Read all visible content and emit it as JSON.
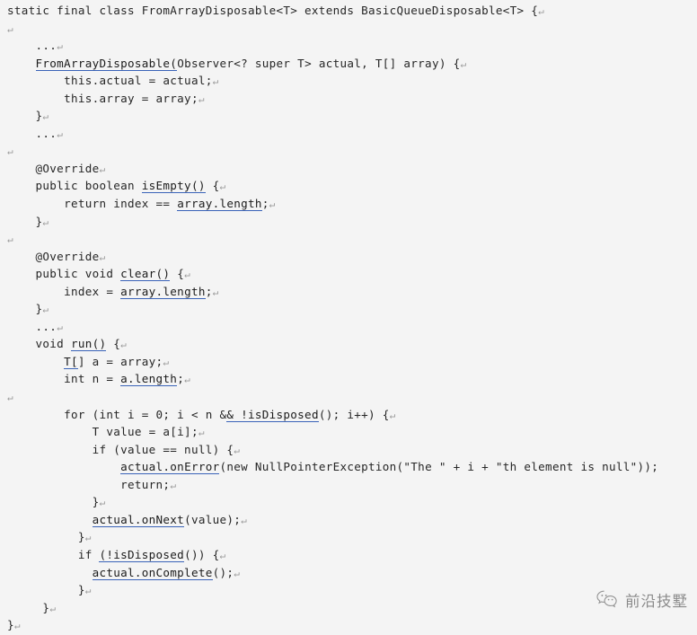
{
  "document": {
    "type": "source-code-screenshot",
    "language": "Java",
    "background_color": "#f4f4f4",
    "text_color": "#262626",
    "link_underline_color": "#3a63b8",
    "cr_glyph": "↵",
    "cr_color": "#9a9a9a"
  },
  "code": {
    "lines": [
      {
        "indent": 0,
        "tokens": [
          {
            "t": "static final class FromArrayDisposable<T> extends BasicQueueDisposable<T> {",
            "k": "plain"
          }
        ],
        "cr": true
      },
      {
        "indent": 0,
        "tokens": [],
        "cr": true
      },
      {
        "indent": 4,
        "tokens": [
          {
            "t": "...",
            "k": "plain"
          }
        ],
        "cr": true
      },
      {
        "indent": 4,
        "tokens": [
          {
            "t": "FromArrayDisposable(",
            "k": "link"
          },
          {
            "t": "Observer<? super T> actual, T[] array) {",
            "k": "plain"
          }
        ],
        "cr": true
      },
      {
        "indent": 8,
        "tokens": [
          {
            "t": "this.actual = actual;",
            "k": "plain"
          }
        ],
        "cr": true
      },
      {
        "indent": 8,
        "tokens": [
          {
            "t": "this.array = array;",
            "k": "plain"
          }
        ],
        "cr": true
      },
      {
        "indent": 4,
        "tokens": [
          {
            "t": "}",
            "k": "plain"
          }
        ],
        "cr": true
      },
      {
        "indent": 4,
        "tokens": [
          {
            "t": "...",
            "k": "plain"
          }
        ],
        "cr": true
      },
      {
        "indent": 0,
        "tokens": [],
        "cr": true
      },
      {
        "indent": 4,
        "tokens": [
          {
            "t": "@Override",
            "k": "plain"
          }
        ],
        "cr": true
      },
      {
        "indent": 4,
        "tokens": [
          {
            "t": "public boolean ",
            "k": "plain"
          },
          {
            "t": "isEmpty()",
            "k": "link"
          },
          {
            "t": " {",
            "k": "plain"
          }
        ],
        "cr": true
      },
      {
        "indent": 8,
        "tokens": [
          {
            "t": "return index == ",
            "k": "plain"
          },
          {
            "t": "array.length",
            "k": "link"
          },
          {
            "t": ";",
            "k": "plain"
          }
        ],
        "cr": true
      },
      {
        "indent": 4,
        "tokens": [
          {
            "t": "}",
            "k": "plain"
          }
        ],
        "cr": true
      },
      {
        "indent": 0,
        "tokens": [],
        "cr": true
      },
      {
        "indent": 4,
        "tokens": [
          {
            "t": "@Override",
            "k": "plain"
          }
        ],
        "cr": true
      },
      {
        "indent": 4,
        "tokens": [
          {
            "t": "public void ",
            "k": "plain"
          },
          {
            "t": "clear()",
            "k": "link"
          },
          {
            "t": " {",
            "k": "plain"
          }
        ],
        "cr": true
      },
      {
        "indent": 8,
        "tokens": [
          {
            "t": "index = ",
            "k": "plain"
          },
          {
            "t": "array.length",
            "k": "link"
          },
          {
            "t": ";",
            "k": "plain"
          }
        ],
        "cr": true
      },
      {
        "indent": 4,
        "tokens": [
          {
            "t": "}",
            "k": "plain"
          }
        ],
        "cr": true
      },
      {
        "indent": 4,
        "tokens": [
          {
            "t": "...",
            "k": "plain"
          }
        ],
        "cr": true
      },
      {
        "indent": 4,
        "tokens": [
          {
            "t": "void ",
            "k": "plain"
          },
          {
            "t": "run()",
            "k": "link"
          },
          {
            "t": " {",
            "k": "plain"
          }
        ],
        "cr": true
      },
      {
        "indent": 8,
        "tokens": [
          {
            "t": "T[",
            "k": "link"
          },
          {
            "t": "] a = array;",
            "k": "plain"
          }
        ],
        "cr": true
      },
      {
        "indent": 8,
        "tokens": [
          {
            "t": "int n = ",
            "k": "plain"
          },
          {
            "t": "a.length",
            "k": "link"
          },
          {
            "t": ";",
            "k": "plain"
          }
        ],
        "cr": true
      },
      {
        "indent": 0,
        "tokens": [],
        "cr": true
      },
      {
        "indent": 8,
        "tokens": [
          {
            "t": "for (int i = 0; i < n &",
            "k": "plain"
          },
          {
            "t": "& !isDisposed",
            "k": "link"
          },
          {
            "t": "(); i++) {",
            "k": "plain"
          }
        ],
        "cr": true
      },
      {
        "indent": 12,
        "tokens": [
          {
            "t": "T value = a[i];",
            "k": "plain"
          }
        ],
        "cr": true
      },
      {
        "indent": 12,
        "tokens": [
          {
            "t": "if (value == null) {",
            "k": "plain"
          }
        ],
        "cr": true
      },
      {
        "indent": 16,
        "tokens": [
          {
            "t": "actual.onError",
            "k": "link"
          },
          {
            "t": "(new NullPointerException(\"The \" + i + \"th element is null\"));",
            "k": "plain"
          }
        ],
        "cr": false
      },
      {
        "indent": 16,
        "tokens": [
          {
            "t": "return;",
            "k": "plain"
          }
        ],
        "cr": true
      },
      {
        "indent": 12,
        "tokens": [
          {
            "t": "}",
            "k": "plain"
          }
        ],
        "cr": true
      },
      {
        "indent": 12,
        "tokens": [
          {
            "t": "actual.onNext",
            "k": "link"
          },
          {
            "t": "(value);",
            "k": "plain"
          }
        ],
        "cr": true
      },
      {
        "indent": 10,
        "tokens": [
          {
            "t": "}",
            "k": "plain"
          }
        ],
        "cr": true
      },
      {
        "indent": 10,
        "tokens": [
          {
            "t": "if ",
            "k": "plain"
          },
          {
            "t": "(!isDisposed",
            "k": "link"
          },
          {
            "t": "()) {",
            "k": "plain"
          }
        ],
        "cr": true
      },
      {
        "indent": 12,
        "tokens": [
          {
            "t": "actual.onComplete",
            "k": "link"
          },
          {
            "t": "();",
            "k": "plain"
          }
        ],
        "cr": true
      },
      {
        "indent": 10,
        "tokens": [
          {
            "t": "}",
            "k": "plain"
          }
        ],
        "cr": true
      },
      {
        "indent": 5,
        "tokens": [
          {
            "t": "}",
            "k": "plain"
          }
        ],
        "cr": true
      },
      {
        "indent": 0,
        "tokens": [
          {
            "t": "}",
            "k": "plain"
          }
        ],
        "cr": true
      }
    ]
  },
  "watermark": {
    "icon": "wechat-logo-icon",
    "label": "前沿技墅",
    "color": "#4a4a4a"
  }
}
